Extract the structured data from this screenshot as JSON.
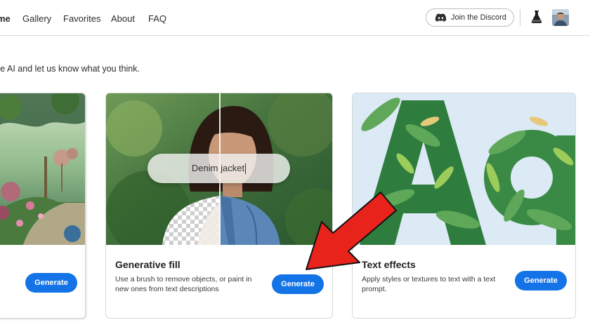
{
  "nav": {
    "home": "me",
    "gallery": "Gallery",
    "favorites": "Favorites",
    "about": "About",
    "faq": "FAQ"
  },
  "header": {
    "discord_label": "Join the Discord"
  },
  "intro_text": "ve AI and let us know what you think.",
  "cards": [
    {
      "generate_label": "Generate"
    },
    {
      "title": "Generative fill",
      "description": "Use a brush to remove objects, or paint in new ones from text descriptions",
      "prompt_text": "Denim jacket",
      "generate_label": "Generate"
    },
    {
      "title": "Text effects",
      "description": "Apply styles or textures to text with a text prompt.",
      "generate_label": "Generate"
    }
  ],
  "colors": {
    "accent": "#1473e6",
    "arrow": "#e8231c"
  },
  "icons": {
    "discord": "discord-icon",
    "labs": "flask-icon",
    "avatar": "avatar"
  }
}
